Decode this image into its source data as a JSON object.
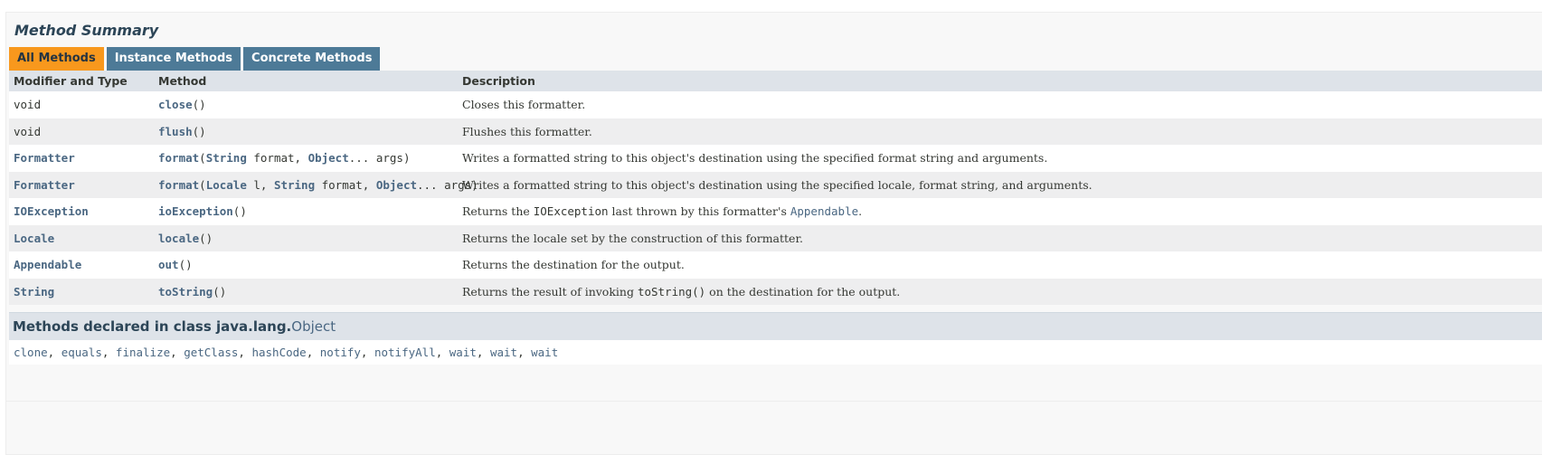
{
  "section": {
    "title": "Method Summary"
  },
  "tabs": [
    {
      "label": "All Methods",
      "active": true
    },
    {
      "label": "Instance Methods",
      "active": false
    },
    {
      "label": "Concrete Methods",
      "active": false
    }
  ],
  "table": {
    "headers": {
      "type": "Modifier and Type",
      "method": "Method",
      "description": "Description"
    },
    "rows": [
      {
        "type": "void",
        "method_name": "close",
        "params": "()",
        "description": "Closes this formatter."
      },
      {
        "type": "void",
        "method_name": "flush",
        "params": "()",
        "description": "Flushes this formatter."
      },
      {
        "type": "Formatter",
        "method_name": "format",
        "params_open": "(",
        "p1_type": "String",
        "p1_text": " format, ",
        "p2_type": "Object",
        "p2_text": "... args)",
        "description": "Writes a formatted string to this object's destination using the specified format string and arguments."
      },
      {
        "type": "Formatter",
        "method_name": "format",
        "params_open": "(",
        "p1_type": "Locale",
        "p1_text": " l, ",
        "p2_type": "String",
        "p2_text": " format, ",
        "p3_type": "Object",
        "p3_text": "... args)",
        "description": "Writes a formatted string to this object's destination using the specified locale, format string, and arguments."
      },
      {
        "type": "IOException",
        "method_name": "ioException",
        "params": "()",
        "desc_pre": "Returns the ",
        "desc_code": "IOException",
        "desc_mid": " last thrown by this formatter's ",
        "desc_link": "Appendable",
        "desc_post": "."
      },
      {
        "type": "Locale",
        "method_name": "locale",
        "params": "()",
        "description": "Returns the locale set by the construction of this formatter."
      },
      {
        "type": "Appendable",
        "method_name": "out",
        "params": "()",
        "description": "Returns the destination for the output."
      },
      {
        "type": "String",
        "method_name": "toString",
        "params": "()",
        "desc_pre": "Returns the result of invoking ",
        "desc_code": "toString()",
        "desc_post": " on the destination for the output."
      }
    ]
  },
  "inherited": {
    "label_prefix": "Methods declared in class java.lang.",
    "class_link": "Object",
    "methods": [
      "clone",
      "equals",
      "finalize",
      "getClass",
      "hashCode",
      "notify",
      "notifyAll",
      "wait",
      "wait",
      "wait"
    ],
    "separator": ", "
  }
}
